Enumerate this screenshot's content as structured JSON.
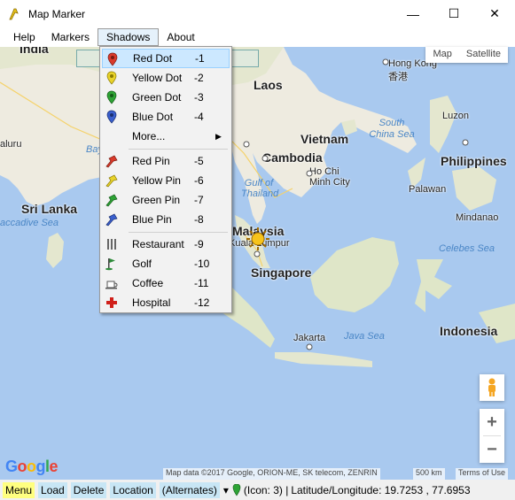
{
  "window": {
    "title": "Map Marker",
    "minimize_glyph": "—",
    "maximize_glyph": "☐",
    "close_glyph": "✕"
  },
  "menubar": {
    "items": [
      {
        "label": "Help"
      },
      {
        "label": "Markers"
      },
      {
        "label": "Shadows"
      },
      {
        "label": "About"
      }
    ]
  },
  "map": {
    "type_buttons": [
      "Map",
      "Satellite"
    ],
    "zoom_in": "+",
    "zoom_out": "−",
    "google_logo": [
      "G",
      "o",
      "o",
      "g",
      "l",
      "e"
    ],
    "google_colors": [
      "#4285f4",
      "#ea4335",
      "#fbbc05",
      "#4285f4",
      "#34a853",
      "#ea4335"
    ],
    "attribution": "Map data ©2017 Google, ORION-ME, SK telecom, ZENRIN",
    "scale": "500 km",
    "terms": "Terms of Use",
    "labels": {
      "india": "India",
      "laos": "Laos",
      "hong_kong": "Hong Kong",
      "hong_kong_cn": "香港",
      "luzon": "Luzon",
      "south_china_sea": "South\nChina Sea",
      "vietnam": "Vietnam",
      "cambodia": "Cambodia",
      "ho_chi_minh": "Ho Chi\nMinh City",
      "philippines": "Philippines",
      "palawan": "Palawan",
      "mindanao": "Mindanao",
      "sri_lanka": "Sri Lanka",
      "laccadive_sea": "accadive Sea",
      "gulf_thailand": "Gulf of\nThailand",
      "malaysia": "Malaysia",
      "kuala_lumpur": "Kuala Lumpur",
      "singapore": "Singapore",
      "celebes_sea": "Celebes Sea",
      "indonesia": "Indonesia",
      "jakarta": "Jakarta",
      "java_sea": "Java Sea",
      "bay": "Bay",
      "aluru": "aluru"
    }
  },
  "shadows_menu": {
    "items": [
      {
        "label": "Red Dot",
        "key": "-1",
        "icon": "red-dot-icon",
        "color": "#d93a2b"
      },
      {
        "label": "Yellow Dot",
        "key": "-2",
        "icon": "yellow-dot-icon",
        "color": "#e8d22a"
      },
      {
        "label": "Green Dot",
        "key": "-3",
        "icon": "green-dot-icon",
        "color": "#2ea335"
      },
      {
        "label": "Blue Dot",
        "key": "-4",
        "icon": "blue-dot-icon",
        "color": "#3a5fcd"
      },
      {
        "label": "More...",
        "key": "",
        "icon": "",
        "color": ""
      },
      {
        "label": "Red Pin",
        "key": "-5",
        "icon": "red-pin-icon",
        "color": "#d93a2b"
      },
      {
        "label": "Yellow Pin",
        "key": "-6",
        "icon": "yellow-pin-icon",
        "color": "#e8d22a"
      },
      {
        "label": "Green Pin",
        "key": "-7",
        "icon": "green-pin-icon",
        "color": "#2ea335"
      },
      {
        "label": "Blue Pin",
        "key": "-8",
        "icon": "blue-pin-icon",
        "color": "#3a5fcd"
      },
      {
        "label": "Restaurant",
        "key": "-9",
        "icon": "restaurant-icon",
        "color": "#666666"
      },
      {
        "label": "Golf",
        "key": "-10",
        "icon": "golf-icon",
        "color": "#2e8b3a"
      },
      {
        "label": "Coffee",
        "key": "-11",
        "icon": "coffee-icon",
        "color": "#555555"
      },
      {
        "label": "Hospital",
        "key": "-12",
        "icon": "hospital-icon",
        "color": "#d0201a"
      }
    ],
    "more_arrow": "▶"
  },
  "statusbar": {
    "menu": "Menu",
    "load": "Load",
    "delete": "Delete",
    "location": "Location",
    "alternates": "(Alternates)",
    "dropdown_glyph": "▾",
    "icon_info": "(Icon:   3) |",
    "coordinates": "Latitude/Longitude: 19.7253 , 77.6953"
  }
}
